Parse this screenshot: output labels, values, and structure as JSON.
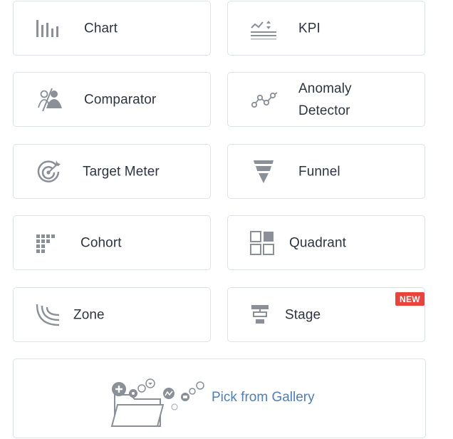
{
  "widgets": [
    {
      "label": "Chart",
      "icon": "bar-chart-icon"
    },
    {
      "label": "KPI",
      "icon": "kpi-icon"
    },
    {
      "label": "Comparator",
      "icon": "comparator-icon"
    },
    {
      "label": "Anomaly\nDetector",
      "icon": "anomaly-detector-icon"
    },
    {
      "label": "Target Meter",
      "icon": "target-meter-icon"
    },
    {
      "label": "Funnel",
      "icon": "funnel-icon"
    },
    {
      "label": "Cohort",
      "icon": "cohort-icon"
    },
    {
      "label": "Quadrant",
      "icon": "quadrant-icon"
    },
    {
      "label": "Zone",
      "icon": "zone-icon"
    },
    {
      "label": "Stage",
      "icon": "stage-icon"
    }
  ],
  "stage_badge": "NEW",
  "gallery": {
    "label": "Pick from Gallery",
    "icon": "gallery-folder-icon"
  },
  "colors": {
    "text": "#2e3440",
    "icon": "#8a8f98",
    "border": "#dde3ea",
    "badge": "#e8433c",
    "link": "#4f7fb4"
  }
}
